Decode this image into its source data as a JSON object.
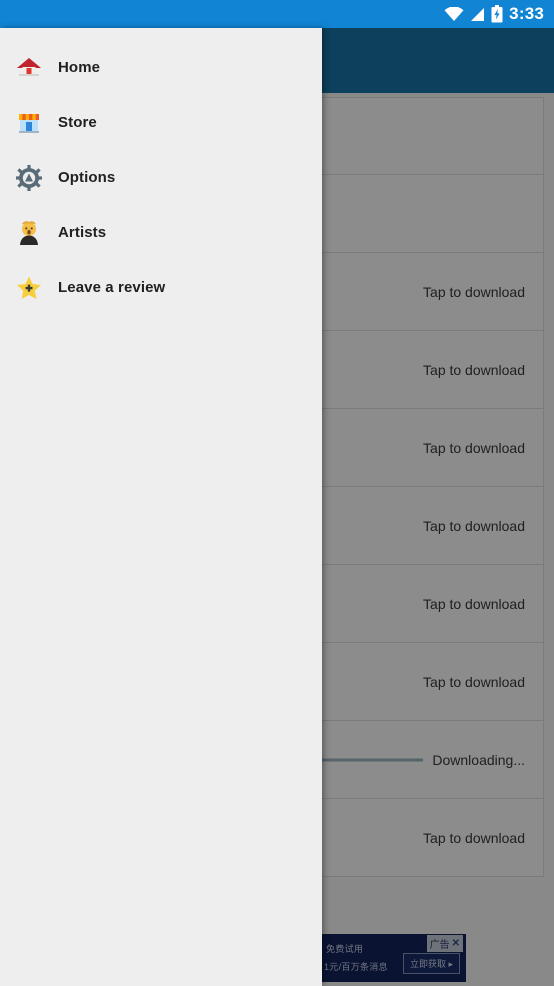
{
  "status_bar": {
    "icons": [
      "wifi-icon",
      "signal-icon",
      "battery-charging-icon"
    ],
    "time": "3:33",
    "background": "#1184d4"
  },
  "toolbar": {
    "background": "#1976a8"
  },
  "drawer": {
    "background": "#eeeeee",
    "items": [
      {
        "label": "Home",
        "icon": "house-icon"
      },
      {
        "label": "Store",
        "icon": "store-icon"
      },
      {
        "label": "Options",
        "icon": "gear-icon"
      },
      {
        "label": "Artists",
        "icon": "artist-icon"
      },
      {
        "label": "Leave a review",
        "icon": "star-icon"
      }
    ]
  },
  "list": {
    "rows": [
      {
        "status": ""
      },
      {
        "status": ""
      },
      {
        "status": "Tap to download"
      },
      {
        "status": "Tap to download"
      },
      {
        "status": "Tap to download"
      },
      {
        "status": "Tap to download"
      },
      {
        "status": "Tap to download"
      },
      {
        "status": "Tap to download"
      },
      {
        "status": "Downloading...",
        "progress": true
      },
      {
        "status": "Tap to download"
      }
    ]
  },
  "ad": {
    "line1": "免费试用",
    "line2": "1元/百万条消息",
    "label": "广告",
    "close": "✕",
    "cta": "立即获取 ▸",
    "background": "#13235c"
  }
}
